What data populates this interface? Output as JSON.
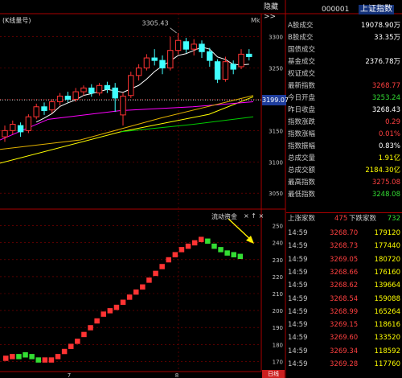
{
  "header": {
    "hide_label": "隐藏>>",
    "index_code": "000001",
    "index_name": "上证指数",
    "chart_mode": "(K线量号)",
    "chart_mode_right": "Mk",
    "price_tag": "3199.07",
    "peak_label": "3305.43",
    "indicator_label": "流动资金",
    "indicator_icons": "× ↑ ×",
    "date_button": "日线",
    "axis_x_labels": [
      "7",
      "8"
    ]
  },
  "price_axis": [
    "3300",
    "3250",
    "3200",
    "3150",
    "3100",
    "3050"
  ],
  "ind_axis": [
    "250",
    "240",
    "230",
    "220",
    "210",
    "200",
    "190",
    "180",
    "170"
  ],
  "quote": [
    {
      "label": "A股成交",
      "value": "19078.90万",
      "color": "#ffffff"
    },
    {
      "label": "B股成交",
      "value": "33.35万",
      "color": "#ffffff"
    },
    {
      "label": "国债成交",
      "value": "",
      "color": "#ffffff"
    },
    {
      "label": "基金成交",
      "value": "2376.78万",
      "color": "#ffffff"
    },
    {
      "label": "权证成交",
      "value": "",
      "color": "#ffffff"
    },
    {
      "label": "最新指数",
      "value": "3268.77",
      "color": "#ff4040"
    },
    {
      "label": "今日开盘",
      "value": "3253.24",
      "color": "#33dd33"
    },
    {
      "label": "昨日收盘",
      "value": "3268.43",
      "color": "#ffffff"
    },
    {
      "label": "指数涨跌",
      "value": "0.29",
      "color": "#ff4040"
    },
    {
      "label": "指数涨幅",
      "value": "0.01%",
      "color": "#ff4040"
    },
    {
      "label": "指数振幅",
      "value": "0.83%",
      "color": "#ffffff"
    },
    {
      "label": "总成交量",
      "value": "1.91亿",
      "color": "#ffff00"
    },
    {
      "label": "总成交额",
      "value": "2184.30亿",
      "color": "#ffff00"
    },
    {
      "label": "最高指数",
      "value": "3275.08",
      "color": "#ff4040"
    },
    {
      "label": "最低指数",
      "value": "3248.08",
      "color": "#33dd33"
    }
  ],
  "breadth": {
    "up_label": "上涨家数",
    "up_value": "475",
    "down_label": "下跌家数",
    "down_value": "732"
  },
  "ticks": [
    {
      "time": "14:59",
      "price": "3268.70",
      "vol": "179120"
    },
    {
      "time": "14:59",
      "price": "3268.73",
      "vol": "177440"
    },
    {
      "time": "14:59",
      "price": "3269.05",
      "vol": "180720"
    },
    {
      "time": "14:59",
      "price": "3268.66",
      "vol": "176160"
    },
    {
      "time": "14:59",
      "price": "3268.62",
      "vol": "139664"
    },
    {
      "time": "14:59",
      "price": "3268.54",
      "vol": "159088"
    },
    {
      "time": "14:59",
      "price": "3268.99",
      "vol": "165264"
    },
    {
      "time": "14:59",
      "price": "3269.15",
      "vol": "118616"
    },
    {
      "time": "14:59",
      "price": "3269.60",
      "vol": "133520"
    },
    {
      "time": "14:59",
      "price": "3269.34",
      "vol": "118592"
    },
    {
      "time": "14:59",
      "price": "3269.28",
      "vol": "117760"
    }
  ],
  "colors": {
    "up": "#ff3333",
    "down": "#33dd33",
    "ma1": "#ffffff",
    "ma2": "#ffff00",
    "ma3": "#ff00ff",
    "ma4": "#00cc00",
    "grid": "#8b0000",
    "axis": "#aa0000"
  },
  "candles": [
    {
      "o": 3140,
      "c": 3150,
      "h": 3158,
      "l": 3132
    },
    {
      "o": 3150,
      "c": 3160,
      "h": 3166,
      "l": 3144
    },
    {
      "o": 3158,
      "c": 3148,
      "h": 3163,
      "l": 3140
    },
    {
      "o": 3150,
      "c": 3172,
      "h": 3176,
      "l": 3146
    },
    {
      "o": 3172,
      "c": 3188,
      "h": 3193,
      "l": 3168
    },
    {
      "o": 3188,
      "c": 3182,
      "h": 3195,
      "l": 3175
    },
    {
      "o": 3183,
      "c": 3196,
      "h": 3200,
      "l": 3178
    },
    {
      "o": 3196,
      "c": 3205,
      "h": 3210,
      "l": 3190
    },
    {
      "o": 3205,
      "c": 3200,
      "h": 3212,
      "l": 3195
    },
    {
      "o": 3200,
      "c": 3212,
      "h": 3218,
      "l": 3196
    },
    {
      "o": 3212,
      "c": 3218,
      "h": 3222,
      "l": 3206
    },
    {
      "o": 3218,
      "c": 3210,
      "h": 3224,
      "l": 3204
    },
    {
      "o": 3210,
      "c": 3222,
      "h": 3226,
      "l": 3206
    },
    {
      "o": 3222,
      "c": 3216,
      "h": 3228,
      "l": 3210
    },
    {
      "o": 3218,
      "c": 3202,
      "h": 3226,
      "l": 3180
    },
    {
      "o": 3175,
      "c": 3205,
      "h": 3210,
      "l": 3158
    },
    {
      "o": 3206,
      "c": 3238,
      "h": 3244,
      "l": 3202
    },
    {
      "o": 3238,
      "c": 3250,
      "h": 3256,
      "l": 3230
    },
    {
      "o": 3250,
      "c": 3266,
      "h": 3272,
      "l": 3246
    },
    {
      "o": 3266,
      "c": 3262,
      "h": 3280,
      "l": 3254
    },
    {
      "o": 3262,
      "c": 3250,
      "h": 3270,
      "l": 3240
    },
    {
      "o": 3250,
      "c": 3278,
      "h": 3300,
      "l": 3246
    },
    {
      "o": 3278,
      "c": 3294,
      "h": 3306,
      "l": 3272
    },
    {
      "o": 3292,
      "c": 3280,
      "h": 3298,
      "l": 3274
    },
    {
      "o": 3280,
      "c": 3288,
      "h": 3296,
      "l": 3270
    },
    {
      "o": 3288,
      "c": 3276,
      "h": 3294,
      "l": 3266
    },
    {
      "o": 3276,
      "c": 3262,
      "h": 3282,
      "l": 3252
    },
    {
      "o": 3260,
      "c": 3232,
      "h": 3264,
      "l": 3226
    },
    {
      "o": 3232,
      "c": 3260,
      "h": 3268,
      "l": 3228
    },
    {
      "o": 3256,
      "c": 3248,
      "h": 3262,
      "l": 3240
    },
    {
      "o": 3252,
      "c": 3272,
      "h": 3280,
      "l": 3248
    },
    {
      "o": 3272,
      "c": 3268,
      "h": 3280,
      "l": 3262
    }
  ],
  "ind_points": [
    {
      "v": 172,
      "d": 0
    },
    {
      "v": 173,
      "d": 0
    },
    {
      "v": 173,
      "d": 1
    },
    {
      "v": 174,
      "d": 1
    },
    {
      "v": 173,
      "d": 1
    },
    {
      "v": 171,
      "d": 1
    },
    {
      "v": 171,
      "d": 0
    },
    {
      "v": 171,
      "d": 0
    },
    {
      "v": 173,
      "d": 0
    },
    {
      "v": 176,
      "d": 0
    },
    {
      "v": 179,
      "d": 0
    },
    {
      "v": 182,
      "d": 0
    },
    {
      "v": 186,
      "d": 0
    },
    {
      "v": 190,
      "d": 0
    },
    {
      "v": 194,
      "d": 0
    },
    {
      "v": 198,
      "d": 0
    },
    {
      "v": 200,
      "d": 0
    },
    {
      "v": 202,
      "d": 0
    },
    {
      "v": 205,
      "d": 0
    },
    {
      "v": 208,
      "d": 0
    },
    {
      "v": 211,
      "d": 0
    },
    {
      "v": 214,
      "d": 0
    },
    {
      "v": 218,
      "d": 0
    },
    {
      "v": 222,
      "d": 0
    },
    {
      "v": 226,
      "d": 0
    },
    {
      "v": 230,
      "d": 0
    },
    {
      "v": 233,
      "d": 0
    },
    {
      "v": 236,
      "d": 0
    },
    {
      "v": 238,
      "d": 0
    },
    {
      "v": 240,
      "d": 0
    },
    {
      "v": 242,
      "d": 0
    },
    {
      "v": 241,
      "d": 1
    },
    {
      "v": 238,
      "d": 1
    },
    {
      "v": 236,
      "d": 1
    },
    {
      "v": 234,
      "d": 1
    },
    {
      "v": 233,
      "d": 1
    },
    {
      "v": 232,
      "d": 1
    }
  ]
}
